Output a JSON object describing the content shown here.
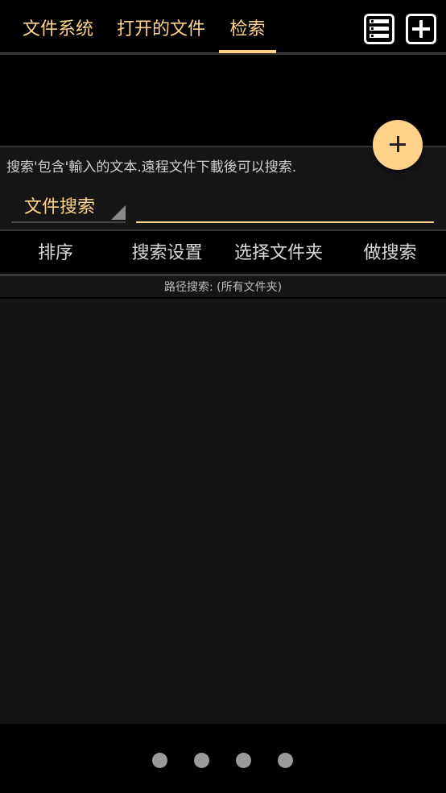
{
  "tabs": [
    {
      "label": "文件系统"
    },
    {
      "label": "打开的文件"
    },
    {
      "label": "检索",
      "active": true
    }
  ],
  "toolbar": {
    "list_icon": "list-menu-icon",
    "add_icon": "plus-square-icon"
  },
  "search": {
    "hint": "搜索'包含'輸入的文本.遠程文件下載後可以搜索.",
    "mode": "文件搜索",
    "input_value": ""
  },
  "fab": {
    "icon": "plus-icon"
  },
  "actions": {
    "sort": "排序",
    "settings": "搜索设置",
    "choose_folder": "选择文件夹",
    "do_search": "做搜索"
  },
  "path": "路径搜索: (所有文件夹)",
  "pager": {
    "count": 4
  },
  "colors": {
    "accent": "#ffd28a",
    "background": "#000000",
    "panel": "#161616"
  }
}
